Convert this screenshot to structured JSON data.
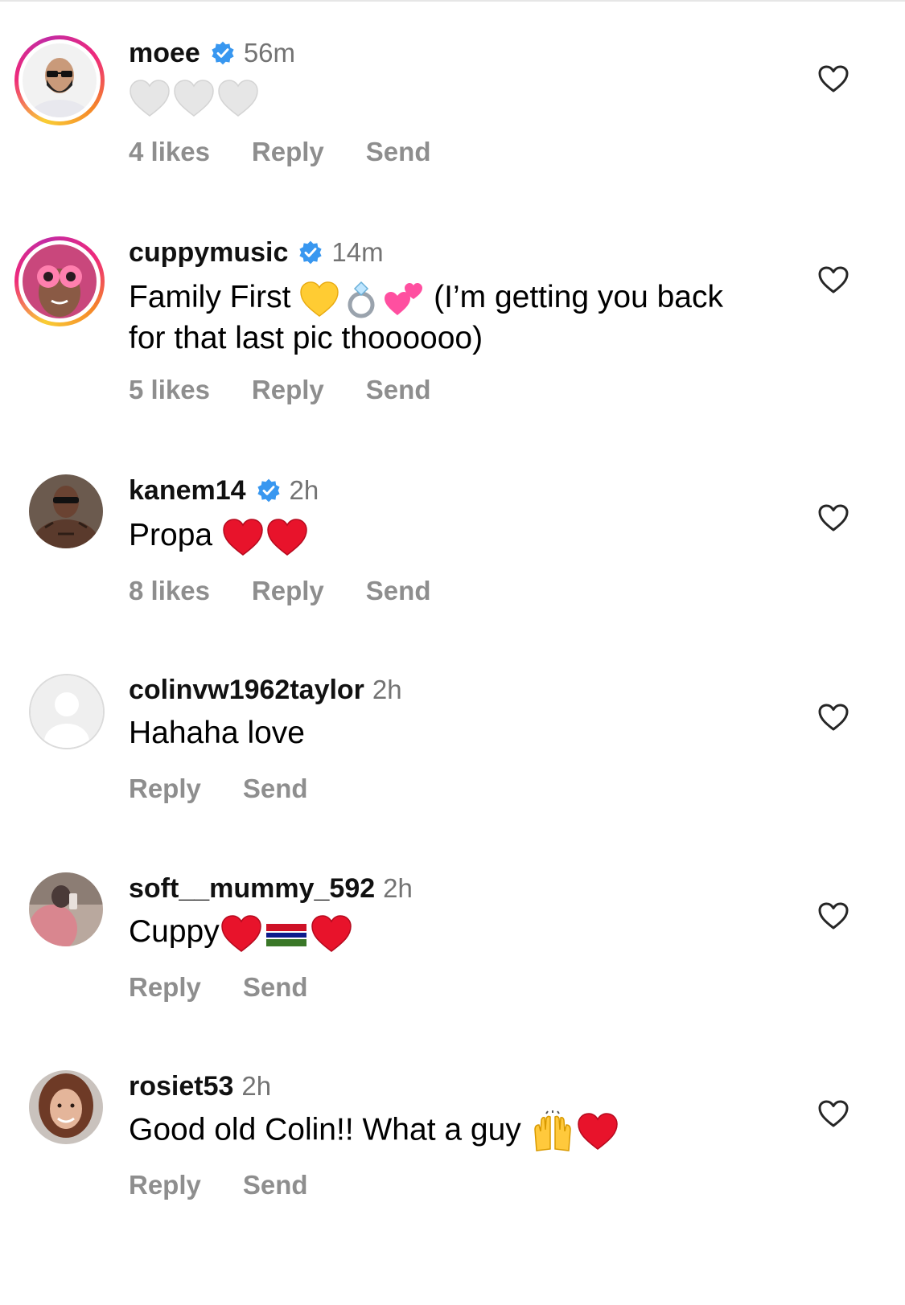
{
  "comments": [
    {
      "username": "moee",
      "verified": true,
      "time": "56m",
      "text": "",
      "emojis": [
        "white-heart",
        "white-heart",
        "white-heart"
      ],
      "likes": "4 likes",
      "reply": "Reply",
      "send": "Send"
    },
    {
      "username": "cuppymusic",
      "verified": true,
      "time": "14m",
      "text_before": "Family First ",
      "emojis": [
        "yellow-heart",
        "ring",
        "two-hearts"
      ],
      "text_after": " (I’m getting you back for that last pic thoooooo)",
      "likes": "5 likes",
      "reply": "Reply",
      "send": "Send"
    },
    {
      "username": "kanem14",
      "verified": true,
      "time": "2h",
      "text": "Propa ",
      "emojis": [
        "red-heart",
        "red-heart"
      ],
      "likes": "8 likes",
      "reply": "Reply",
      "send": "Send"
    },
    {
      "username": "colinvw1962taylor",
      "verified": false,
      "time": "2h",
      "text": "Hahaha love",
      "reply": "Reply",
      "send": "Send"
    },
    {
      "username": "soft__mummy_592",
      "verified": false,
      "time": "2h",
      "text": "Cuppy",
      "emojis": [
        "red-heart",
        "gambia-flag",
        "red-heart"
      ],
      "reply": "Reply",
      "send": "Send"
    },
    {
      "username": "rosiet53",
      "verified": false,
      "time": "2h",
      "text": "Good old Colin!! What a guy ",
      "emojis": [
        "raising-hands",
        "red-heart"
      ],
      "reply": "Reply",
      "send": "Send"
    }
  ],
  "colors": {
    "username": "#111111",
    "meta": "#737373",
    "action": "#8e8e8e",
    "verified": "#3897f0",
    "heart_outline": "#262626"
  }
}
